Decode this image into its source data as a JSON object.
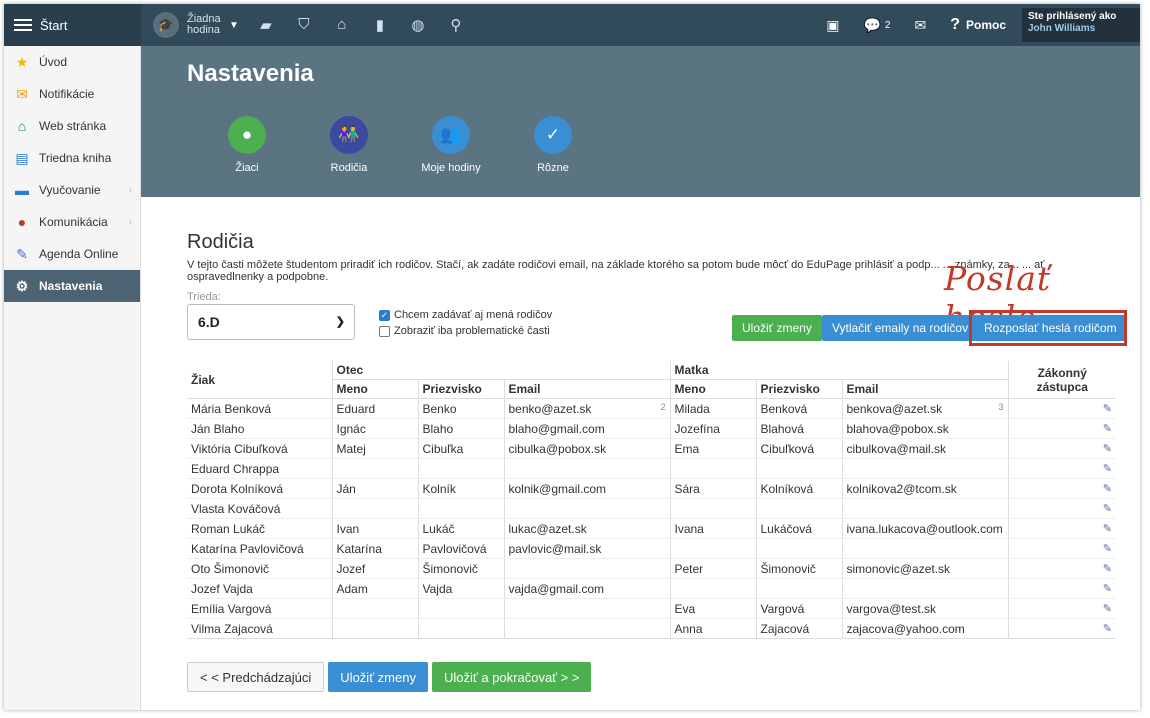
{
  "topbar": {
    "brand": "Štart",
    "lesson_line1": "Žiadna",
    "lesson_line2": "hodina",
    "messages_count": "2",
    "help": "Pomoc",
    "user_line1": "Ste prihlásený ako",
    "user_line2": "John Williams",
    "icons": [
      "briefcase-icon",
      "shield-icon",
      "bank-icon",
      "chart-icon",
      "gauge-icon",
      "walker-icon"
    ]
  },
  "sidebar": {
    "items": [
      {
        "label": "Úvod",
        "icon": "star-icon"
      },
      {
        "label": "Notifikácie",
        "icon": "envelope-icon"
      },
      {
        "label": "Web stránka",
        "icon": "home-icon"
      },
      {
        "label": "Triedna kniha",
        "icon": "book-icon"
      },
      {
        "label": "Vyučovanie",
        "icon": "teacher-icon"
      },
      {
        "label": "Komunikácia",
        "icon": "chat-icon"
      },
      {
        "label": "Agenda Online",
        "icon": "pen-icon"
      },
      {
        "label": "Nastavenia",
        "icon": "gear-icon"
      }
    ]
  },
  "header": {
    "title": "Nastavenia",
    "tabs": [
      {
        "label": "Žiaci",
        "color": "#4caf50"
      },
      {
        "label": "Rodičia",
        "color": "#3b4aa0"
      },
      {
        "label": "Moje hodiny",
        "color": "#3a8fd4"
      },
      {
        "label": "Rôzne",
        "color": "#3a8fd4"
      }
    ]
  },
  "main": {
    "title": "Rodičia",
    "description": "V tejto časti môžete študentom priradiť ich rodičov. Stačí, ak zadáte rodičovi email, na základe ktorého sa potom bude môcť do EduPage prihlásiť a podp... ... známky, za... ... ať ospravedlnenky a podpobne.",
    "trieda_label": "Trieda:",
    "trieda_value": "6.D",
    "check1": "Chcem zadávať aj mená rodičov",
    "check2": "Zobraziť iba problematické časti",
    "btn_save": "Uložiť zmeny",
    "btn_print": "Vytlačiť emaily na rodičov",
    "btn_send": "Rozposlať heslá rodičom",
    "annotation": "Poslať heslo"
  },
  "table": {
    "headers": {
      "student": "Žiak",
      "father": "Otec",
      "mother": "Matka",
      "first": "Meno",
      "last": "Priezvisko",
      "email": "Email",
      "guardian": "Zákonný zástupca"
    },
    "rows": [
      [
        "Mária Benková",
        "Eduard",
        "Benko",
        "benko@azet.sk",
        "2",
        "Milada",
        "Benková",
        "benkova@azet.sk",
        "3"
      ],
      [
        "Ján Blaho",
        "Ignác",
        "Blaho",
        "blaho@gmail.com",
        "",
        "Jozefína",
        "Blahová",
        "blahova@pobox.sk",
        ""
      ],
      [
        "Viktória Cibuľková",
        "Matej",
        "Cibuľka",
        "cibulka@pobox.sk",
        "",
        "Ema",
        "Cibuľková",
        "cibulkova@mail.sk",
        ""
      ],
      [
        "Eduard Chrappa",
        "",
        "",
        "",
        "",
        "",
        "",
        "",
        ""
      ],
      [
        "Dorota Kolníková",
        "Ján",
        "Kolník",
        "kolnik@gmail.com",
        "",
        "Sára",
        "Kolníková",
        "kolnikova2@tcom.sk",
        ""
      ],
      [
        "Vlasta Kováčová",
        "",
        "",
        "",
        "",
        "",
        "",
        "",
        ""
      ],
      [
        "Roman Lukáč",
        "Ivan",
        "Lukáč",
        "lukac@azet.sk",
        "",
        "Ivana",
        "Lukáčová",
        "ivana.lukacova@outlook.com",
        ""
      ],
      [
        "Katarína Pavlovičová",
        "Katarína",
        "Pavlovičová",
        "pavlovic@mail.sk",
        "",
        "",
        "",
        "",
        ""
      ],
      [
        "Oto Šimonovič",
        "Jozef",
        "Šimonovič",
        "",
        "",
        "Peter",
        "Šimonovič",
        "simonovic@azet.sk",
        ""
      ],
      [
        "Jozef Vajda",
        "Adam",
        "Vajda",
        "vajda@gmail.com",
        "",
        "",
        "",
        "",
        ""
      ],
      [
        "Emília Vargová",
        "",
        "",
        "",
        "",
        "Eva",
        "Vargová",
        "vargova@test.sk",
        ""
      ],
      [
        "Vilma Zajacová",
        "",
        "",
        "",
        "",
        "Anna",
        "Zajacová",
        "zajacova@yahoo.com",
        ""
      ]
    ]
  },
  "footer": {
    "prev": "< < Predchádzajúci",
    "save": "Uložiť zmeny",
    "save_next": "Uložiť a pokračovať > >"
  }
}
